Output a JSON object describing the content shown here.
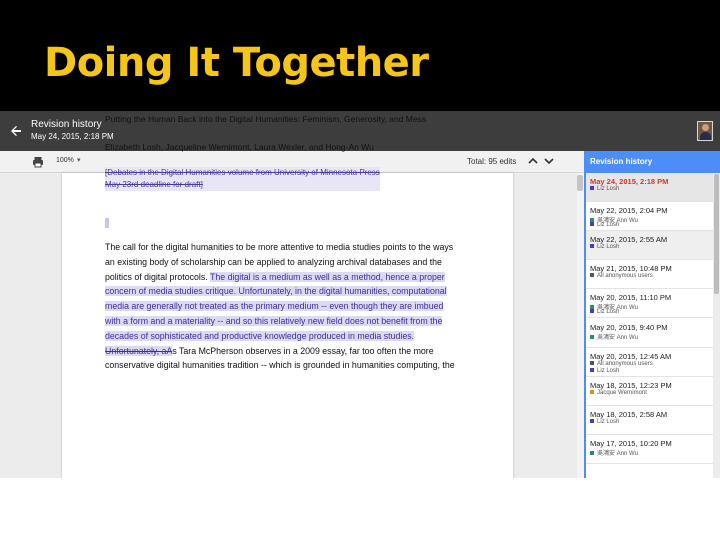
{
  "slide": {
    "title": "Doing It Together"
  },
  "topbar": {
    "title": "Revision history",
    "date": "May 24, 2015, 2:18 PM"
  },
  "toolbar": {
    "zoom": "100%",
    "total_edits": "Total: 95 edits"
  },
  "icons": {
    "back": "arrow-left-icon",
    "print": "printer-icon",
    "zoom_caret": "caret-down-icon",
    "prev": "chevron-up-icon",
    "next": "chevron-down-icon",
    "avatar": "user-avatar"
  },
  "colors": {
    "slide_title": "#f5c518",
    "panel_header": "#4c8df6",
    "current_revision": "#d0382b",
    "suggestion_highlight": "#dcd9f3",
    "suggestion_text": "#3d2fa0"
  },
  "document": {
    "title": "Putting the Human Back into the Digital Humanities: Feminism, Generosity, and Mess",
    "authors": "Elizabeth Losh, Jacqueline Wernimont, Laura Wexler, and Hong-An Wu",
    "note_line1": "[Debates in the Digital Humanities volume from University of Minnesota Press",
    "note_line2": "May 23rd deadline for draft]",
    "p1": "The call for the digital humanities to be more attentive to media studies points to the ways",
    "p2": "an existing body of scholarship can be applied to analyzing archival databases and the",
    "p3a": "politics of digital protocols.  ",
    "p3b": "The digital is a medium as well as a method, hence a proper",
    "p4": "concern of media studies critique. Unfortunately, in the digital humanities, computational",
    "p5": "media are generally not treated as the primary medium -- even though they are imbued",
    "p6": "with a form and a materiality -- and so this relatively new field does not benefit from the",
    "p7": "decades of sophisticated and productive knowledge produced in media studies.",
    "p8a": "Unfortunately, aA",
    "p8b": "s Tara McPherson observes in a 2009 essay, far too often the more",
    "p9": "conservative digital humanities tradition -- which is grounded in humanities computing, the"
  },
  "panel": {
    "title": "Revision history",
    "revisions": [
      {
        "date": "May 24, 2015, 2:18 PM",
        "users": [
          {
            "name": "Liz Losh",
            "color": "#3f3fbf"
          }
        ]
      },
      {
        "date": "May 22, 2015, 2:04 PM",
        "users": [
          {
            "name": "吳鴻安 Ann Wu",
            "color": "#2e8b6e"
          },
          {
            "name": "Liz Losh",
            "color": "#3f3fbf"
          }
        ]
      },
      {
        "date": "May 22, 2015, 2:55 AM",
        "users": [
          {
            "name": "Liz Losh",
            "color": "#3f3fbf"
          }
        ]
      },
      {
        "date": "May 21, 2015, 10:48 PM",
        "users": [
          {
            "name": "All anonymous users",
            "color": "#555555"
          }
        ]
      },
      {
        "date": "May 20, 2015, 11:10 PM",
        "users": [
          {
            "name": "吳鴻安 Ann Wu",
            "color": "#2e8b6e"
          },
          {
            "name": "Liz Losh",
            "color": "#3f3fbf"
          }
        ]
      },
      {
        "date": "May 20, 2015, 9:40 PM",
        "users": [
          {
            "name": "吳鴻安 Ann Wu",
            "color": "#2e8b6e"
          }
        ]
      },
      {
        "date": "May 20, 2015, 12:45 AM",
        "users": [
          {
            "name": "All anonymous users",
            "color": "#555555"
          },
          {
            "name": "Liz Losh",
            "color": "#3f3fbf"
          }
        ]
      },
      {
        "date": "May 18, 2015, 12:23 PM",
        "users": [
          {
            "name": "Jacque Wernimont",
            "color": "#e08a1e"
          }
        ]
      },
      {
        "date": "May 18, 2015, 2:58 AM",
        "users": [
          {
            "name": "Liz Losh",
            "color": "#3f3fbf"
          }
        ]
      },
      {
        "date": "May 17, 2015, 10:20 PM",
        "users": [
          {
            "name": "吳鴻安 Ann Wu",
            "color": "#2e8b6e"
          }
        ]
      }
    ]
  }
}
